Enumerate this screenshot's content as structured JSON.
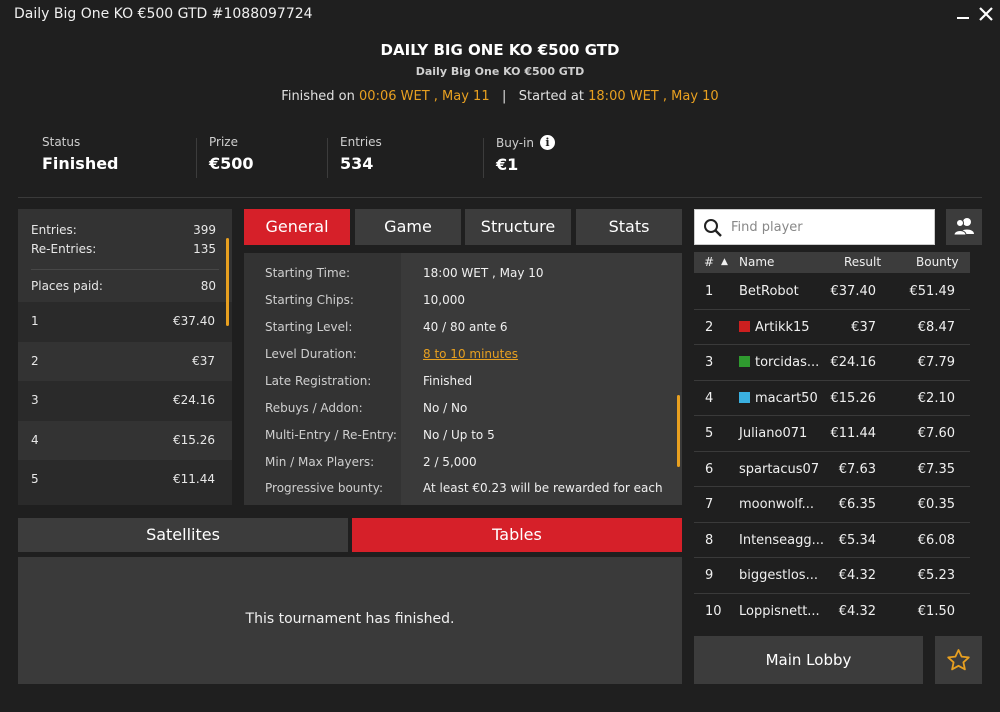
{
  "window": {
    "title": "Daily Big One KO €500 GTD #1088097724"
  },
  "header": {
    "title": "DAILY BIG ONE KO €500 GTD",
    "subtitle": "Daily Big One KO €500 GTD",
    "finished_label": "Finished on",
    "finished_value": "00:06 WET , May 11",
    "separator": "|",
    "started_label": "Started at",
    "started_value": "18:00 WET , May 10"
  },
  "info": {
    "status_label": "Status",
    "status_value": "Finished",
    "prize_label": "Prize",
    "prize_value": "€500",
    "entries_label": "Entries",
    "entries_value": "534",
    "buyin_label": "Buy-in",
    "buyin_value": "€1",
    "info_icon": "i"
  },
  "payout": {
    "entries_label": "Entries:",
    "entries_value": "399",
    "reentries_label": "Re-Entries:",
    "reentries_value": "135",
    "places_label": "Places paid:",
    "places_value": "80",
    "rows": [
      {
        "place": "1",
        "amount": "€37.40"
      },
      {
        "place": "2",
        "amount": "€37"
      },
      {
        "place": "3",
        "amount": "€24.16"
      },
      {
        "place": "4",
        "amount": "€15.26"
      },
      {
        "place": "5",
        "amount": "€11.44"
      }
    ]
  },
  "tabs": {
    "general": "General",
    "game": "Game",
    "structure": "Structure",
    "stats": "Stats"
  },
  "general": {
    "rows": [
      {
        "label": "Starting Time:",
        "value": "18:00 WET , May 10"
      },
      {
        "label": "Starting Chips:",
        "value": "10,000"
      },
      {
        "label": "Starting Level:",
        "value": "40 / 80 ante 6"
      },
      {
        "label": "Level Duration:",
        "value": "8 to 10 minutes"
      },
      {
        "label": "Late Registration:",
        "value": "Finished"
      },
      {
        "label": "Rebuys / Addon:",
        "value": "No / No"
      },
      {
        "label": "Multi-Entry / Re-Entry:",
        "value": "No / Up to 5"
      },
      {
        "label": "Min / Max Players:",
        "value": "2 / 5,000"
      },
      {
        "label": "Progressive bounty:",
        "value": "At least €0.23 will be rewarded for each"
      }
    ]
  },
  "bottom_tabs": {
    "satellites": "Satellites",
    "tables": "Tables"
  },
  "tables_panel": {
    "message": "This tournament has finished."
  },
  "search": {
    "placeholder": "Find player"
  },
  "players": {
    "headers": {
      "rank": "#",
      "sort_arrow": "▲",
      "name": "Name",
      "result": "Result",
      "bounty": "Bounty"
    },
    "rows": [
      {
        "rank": "1",
        "name": "BetRobot",
        "result": "€37.40",
        "bounty": "€51.49",
        "flag": ""
      },
      {
        "rank": "2",
        "name": "Artikk15",
        "result": "€37",
        "bounty": "€8.47",
        "flag": "#cc1f1f"
      },
      {
        "rank": "3",
        "name": "torcidas...",
        "result": "€24.16",
        "bounty": "€7.79",
        "flag": "#2f9a2f"
      },
      {
        "rank": "4",
        "name": "macart50",
        "result": "€15.26",
        "bounty": "€2.10",
        "flag": "#3ab0e0"
      },
      {
        "rank": "5",
        "name": "Juliano071",
        "result": "€11.44",
        "bounty": "€7.60",
        "flag": ""
      },
      {
        "rank": "6",
        "name": "spartacus07",
        "result": "€7.63",
        "bounty": "€7.35",
        "flag": ""
      },
      {
        "rank": "7",
        "name": "moonwolf...",
        "result": "€6.35",
        "bounty": "€0.35",
        "flag": ""
      },
      {
        "rank": "8",
        "name": "Intenseagg...",
        "result": "€5.34",
        "bounty": "€6.08",
        "flag": ""
      },
      {
        "rank": "9",
        "name": "biggestlos...",
        "result": "€4.32",
        "bounty": "€5.23",
        "flag": ""
      },
      {
        "rank": "10",
        "name": "Loppisnett...",
        "result": "€4.32",
        "bounty": "€1.50",
        "flag": ""
      }
    ]
  },
  "footer": {
    "main_lobby": "Main Lobby"
  },
  "colors": {
    "accent": "#d62029",
    "highlight": "#e8a020",
    "background": "#1f1f1f"
  },
  "icons": {
    "minimize": "minimize-icon",
    "close": "close-icon",
    "search": "search-icon",
    "users": "users-icon",
    "favorite": "star-icon",
    "info": "info-icon"
  }
}
